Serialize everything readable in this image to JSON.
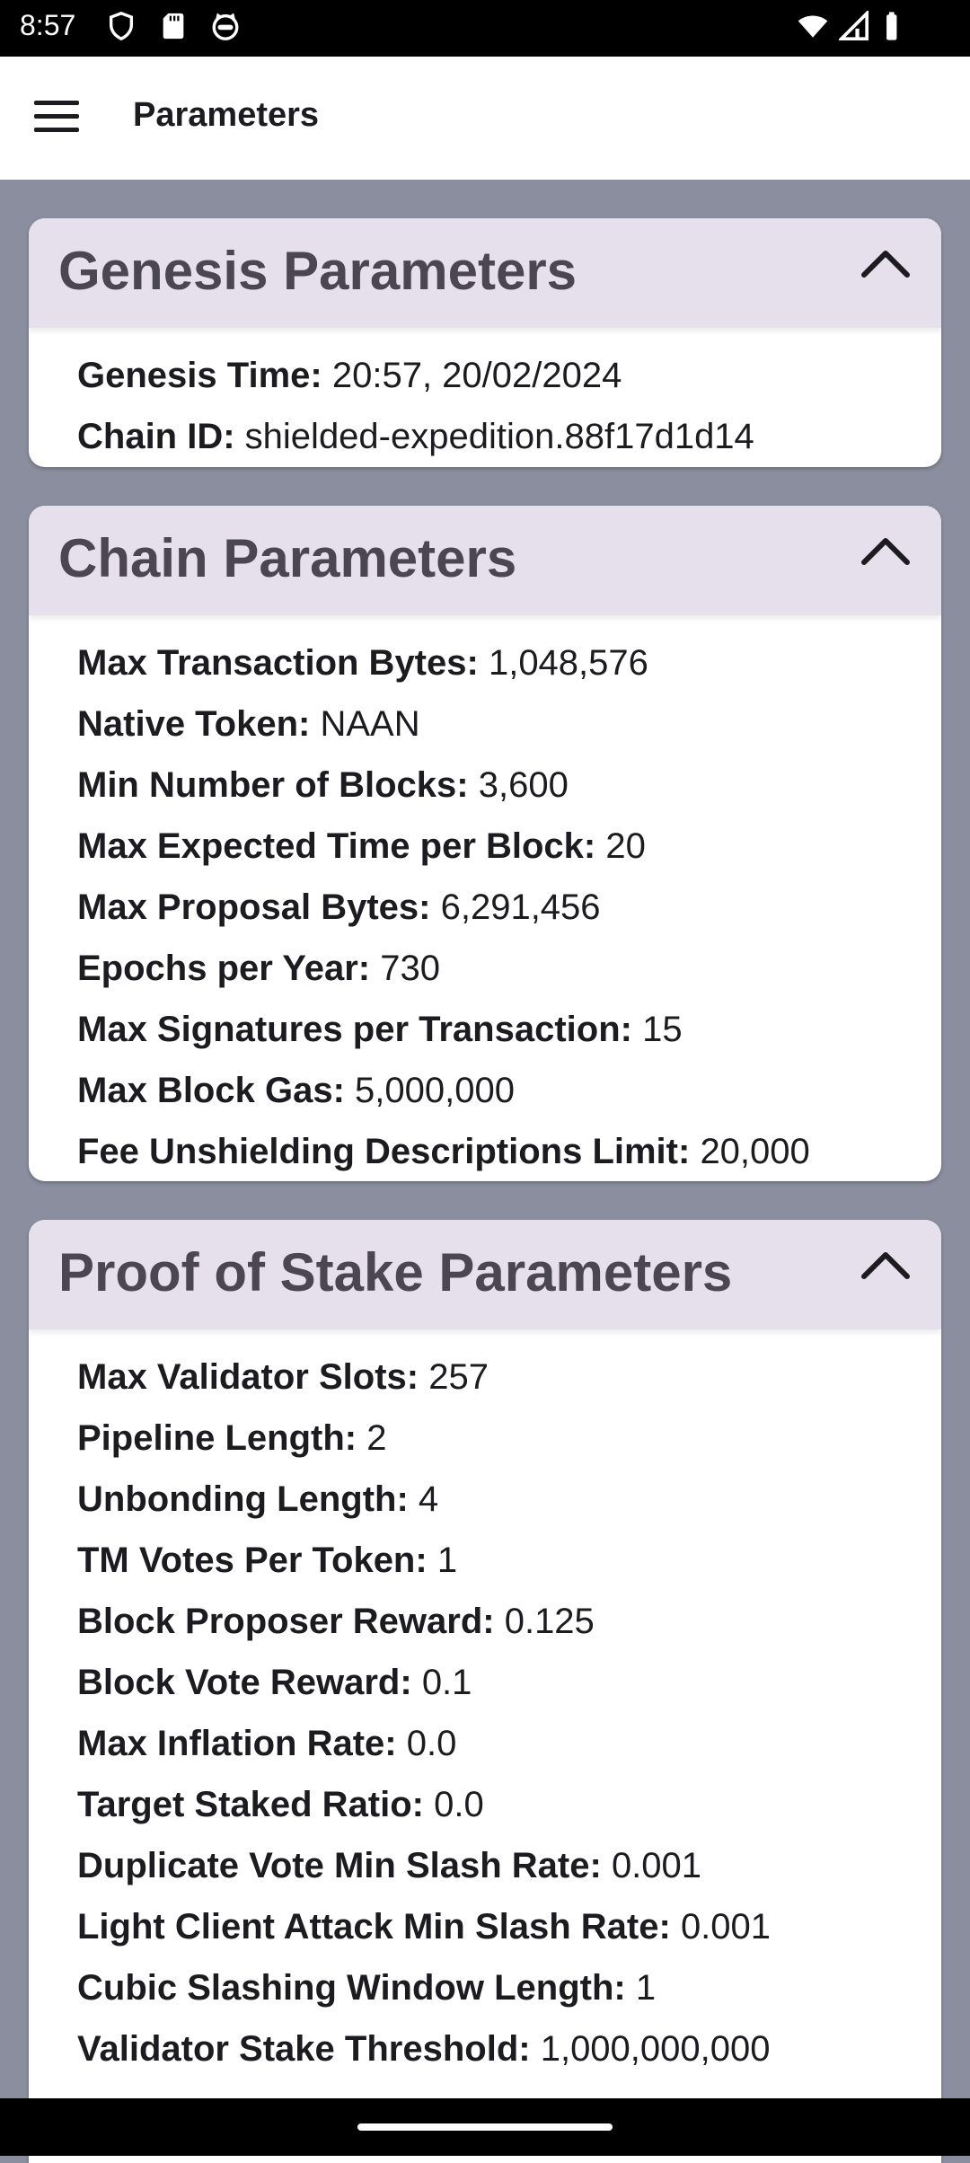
{
  "status_bar": {
    "time": "8:57",
    "left_icons": [
      "shield-icon",
      "sd-card-icon",
      "cat-face-icon"
    ],
    "right_icons": [
      "wifi-icon",
      "cellular-signal-icon",
      "battery-icon"
    ]
  },
  "app_bar": {
    "title": "Parameters",
    "menu_icon": "hamburger-menu-icon"
  },
  "colors": {
    "accent_header": "#e6e0ec",
    "background": "#8a8e9e"
  },
  "genesis": {
    "title": "Genesis Parameters",
    "rows": [
      {
        "label": "Genesis Time:",
        "value": "20:57, 20/02/2024"
      },
      {
        "label": "Chain ID:",
        "value": "shielded-expedition.88f17d1d14"
      }
    ]
  },
  "chain": {
    "title": "Chain Parameters",
    "rows": [
      {
        "label": "Max Transaction Bytes:",
        "value": "1,048,576"
      },
      {
        "label": "Native Token:",
        "value": "NAAN"
      },
      {
        "label": "Min Number of Blocks:",
        "value": "3,600"
      },
      {
        "label": "Max Expected Time per Block:",
        "value": "20"
      },
      {
        "label": "Max Proposal Bytes:",
        "value": "6,291,456"
      },
      {
        "label": "Epochs per Year:",
        "value": "730"
      },
      {
        "label": "Max Signatures per Transaction:",
        "value": "15"
      },
      {
        "label": "Max Block Gas:",
        "value": "5,000,000"
      },
      {
        "label": "Fee Unshielding Descriptions Limit:",
        "value": "20,000"
      }
    ]
  },
  "pos": {
    "title": "Proof of Stake Parameters",
    "rows": [
      {
        "label": "Max Validator Slots:",
        "value": "257"
      },
      {
        "label": "Pipeline Length:",
        "value": "2"
      },
      {
        "label": "Unbonding Length:",
        "value": "4"
      },
      {
        "label": "TM Votes Per Token:",
        "value": "1"
      },
      {
        "label": "Block Proposer Reward:",
        "value": "0.125"
      },
      {
        "label": "Block Vote Reward:",
        "value": "0.1"
      },
      {
        "label": "Max Inflation Rate:",
        "value": "0.0"
      },
      {
        "label": "Target Staked Ratio:",
        "value": "0.0"
      },
      {
        "label": "Duplicate Vote Min Slash Rate:",
        "value": "0.001"
      },
      {
        "label": "Light Client Attack Min Slash Rate:",
        "value": "0.001"
      },
      {
        "label": "Cubic Slashing Window Length:",
        "value": "1"
      },
      {
        "label": "Validator Stake Threshold:",
        "value": "1,000,000,000"
      }
    ]
  }
}
